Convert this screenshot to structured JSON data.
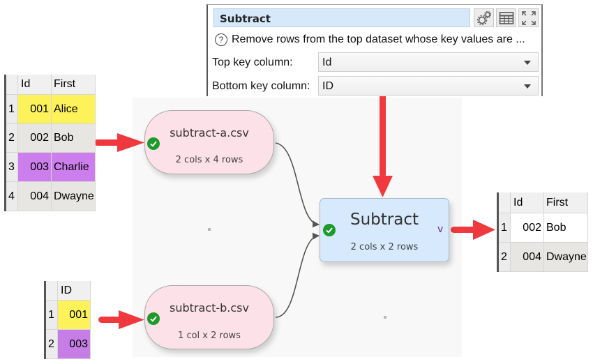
{
  "settings_panel": {
    "title": "Subtract",
    "buttons": [
      {
        "name": "gear-icon",
        "label": "Settings"
      },
      {
        "name": "table-icon",
        "label": "Data"
      },
      {
        "name": "expand-icon",
        "label": "Maximize"
      }
    ],
    "description": "Remove rows from the top dataset whose key values are ...",
    "fields": [
      {
        "label": "Top key column:",
        "value": "Id"
      },
      {
        "label": "Bottom key column:",
        "value": "ID"
      }
    ]
  },
  "table_a": {
    "columns": [
      "Id",
      "First"
    ],
    "rows": [
      {
        "n": "1",
        "id": "001",
        "first": "Alice",
        "highlight": "yellow"
      },
      {
        "n": "2",
        "id": "002",
        "first": "Bob",
        "highlight": "none"
      },
      {
        "n": "3",
        "id": "003",
        "first": "Charlie",
        "highlight": "purple"
      },
      {
        "n": "4",
        "id": "004",
        "first": "Dwayne",
        "highlight": "none"
      }
    ]
  },
  "table_b": {
    "columns": [
      "ID"
    ],
    "rows": [
      {
        "n": "1",
        "id": "001",
        "highlight": "yellow"
      },
      {
        "n": "2",
        "id": "003",
        "highlight": "purple"
      }
    ]
  },
  "table_out": {
    "columns": [
      "Id",
      "First"
    ],
    "rows": [
      {
        "n": "1",
        "id": "002",
        "first": "Bob"
      },
      {
        "n": "2",
        "id": "004",
        "first": "Dwayne"
      }
    ]
  },
  "nodes": {
    "input_a": {
      "name": "subtract-a.csv",
      "dims": "2 cols x 4 rows",
      "status": "ok"
    },
    "input_b": {
      "name": "subtract-b.csv",
      "dims": "1 col x 2 rows",
      "status": "ok"
    },
    "subtract": {
      "name": "Subtract",
      "dims": "2 cols x 2 rows",
      "status": "ok",
      "expander": "v"
    }
  },
  "colors": {
    "arrow": "#f0393f",
    "input_node": "#fde1e9",
    "transform_node": "#d6e9fd",
    "ok": "#1c9a2a",
    "highlight_yellow": "#fdf25a",
    "highlight_purple": "#cc7fec"
  }
}
